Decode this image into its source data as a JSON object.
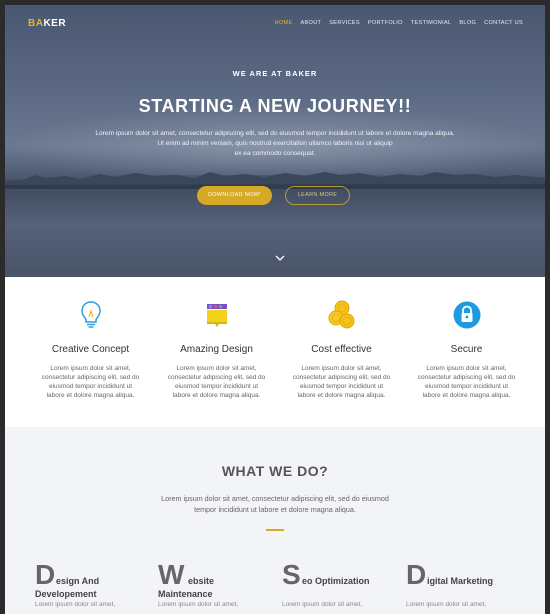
{
  "brand": {
    "part1": "BA",
    "part2": "KER"
  },
  "nav": {
    "items": [
      {
        "label": "HOME",
        "active": true
      },
      {
        "label": "ABOUT"
      },
      {
        "label": "SERVICES"
      },
      {
        "label": "PORTFOLIO"
      },
      {
        "label": "TESTIMONIAL"
      },
      {
        "label": "BLOG"
      },
      {
        "label": "CONTACT US"
      }
    ]
  },
  "hero": {
    "eyebrow": "WE ARE AT BAKER",
    "headline": "STARTING A NEW JOURNEY!!",
    "text_line1": "Lorem ipsum dolor sit amet, consectetur adipiscing elit, sed do eiusmod tempor incididunt ut labore et dolore magna aliqua.",
    "text_line2": "Ut enim ad minim veniam, quis nostrud exercitation ullamco laboris nisi ut aliquip",
    "text_line3": "ex ea commodo consequat.",
    "download_label": "DOWNLOAD NOW!",
    "learn_label": "LEARN MORE"
  },
  "features": [
    {
      "title": "Creative Concept",
      "icon": "lightbulb-icon",
      "line1": "Lorem ipsum dolor sit amet,",
      "line2": "consectetur adipiscing elit, sed do",
      "line3": "eiusmod tempor incididunt ut",
      "line4": "labore et dolore magna aliqua."
    },
    {
      "title": "Amazing Design",
      "icon": "design-palette-icon",
      "line1": "Lorem ipsum dolor sit amet,",
      "line2": "consectetur adipiscing elit, sed do",
      "line3": "eiusmod tempor incididunt ut",
      "line4": "labore et dolore magna aliqua."
    },
    {
      "title": "Cost effective",
      "icon": "coins-icon",
      "line1": "Lorem ipsum dolor sit amet,",
      "line2": "consectetur adipiscing elit, sed do",
      "line3": "eiusmod tempor incididunt ut",
      "line4": "labore et dolore magna aliqua."
    },
    {
      "title": "Secure",
      "icon": "lock-icon",
      "line1": "Lorem ipsum dolor sit amet,",
      "line2": "consectetur adipiscing elit, sed do",
      "line3": "eiusmod tempor incididunt ut",
      "line4": "labore et dolore magna aliqua."
    }
  ],
  "whatwedo": {
    "title": "WHAT WE DO?",
    "text_line1": "Lorem ipsum dolor sit amet, consectetur adipiscing elit, sed do eiusmod",
    "text_line2": "tempor incididunt ut labore et dolore magna aliqua.",
    "services": [
      {
        "initial": "D",
        "line1": "esign And",
        "line2": "Developement",
        "desc": "Lorem ipsum dolor sit amet,"
      },
      {
        "initial": "W",
        "line1": "ebsite",
        "line2": "Maintenance",
        "desc": "Lorem ipsum dolor sit amet,"
      },
      {
        "initial": "S",
        "line1": "eo Optimization",
        "line2": "",
        "desc": "Lorem ipsum dolor sit amet,"
      },
      {
        "initial": "D",
        "line1": "igital Marketing",
        "line2": "",
        "desc": "Lorem ipsum dolor sit amet,"
      }
    ]
  },
  "colors": {
    "accent": "#d4aa26",
    "secure_icon": "#1e9be0"
  }
}
